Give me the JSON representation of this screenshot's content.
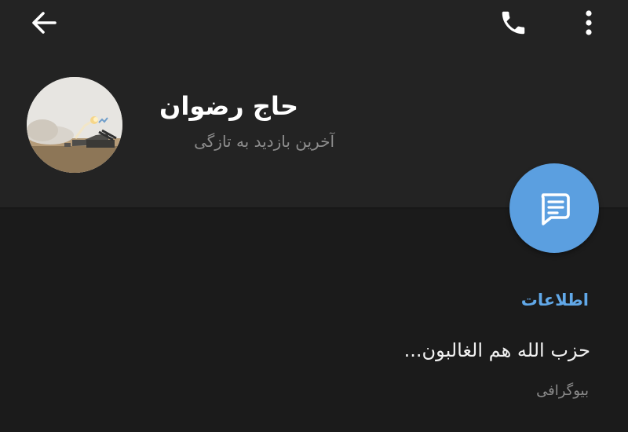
{
  "header": {
    "back_icon": "arrow-left-icon",
    "call_icon": "phone-icon",
    "menu_icon": "more-vertical-icon",
    "background_color": "#232323"
  },
  "profile": {
    "name": "حاج رضوان",
    "status": "آخرین بازدید به تازگی",
    "avatar_icon": "profile-photo"
  },
  "fab": {
    "icon": "message-icon",
    "color": "#5b9fe0"
  },
  "info": {
    "title": "اطلاعات",
    "bio": "حزب الله هم الغالبون...",
    "bio_label": "بیوگرافی",
    "title_color": "#61a8e8"
  }
}
